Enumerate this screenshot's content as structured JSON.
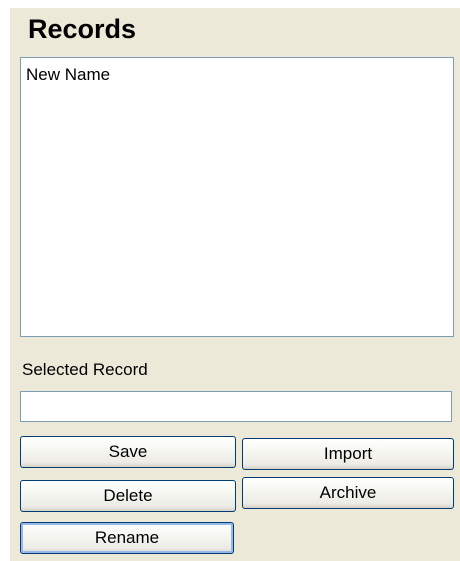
{
  "panel": {
    "title": "Records",
    "records_list": {
      "items": [
        "New Name"
      ]
    },
    "selected_record": {
      "label": "Selected Record",
      "value": ""
    },
    "buttons": {
      "save": "Save",
      "import": "Import",
      "delete": "Delete",
      "archive": "Archive",
      "rename": "Rename"
    }
  }
}
